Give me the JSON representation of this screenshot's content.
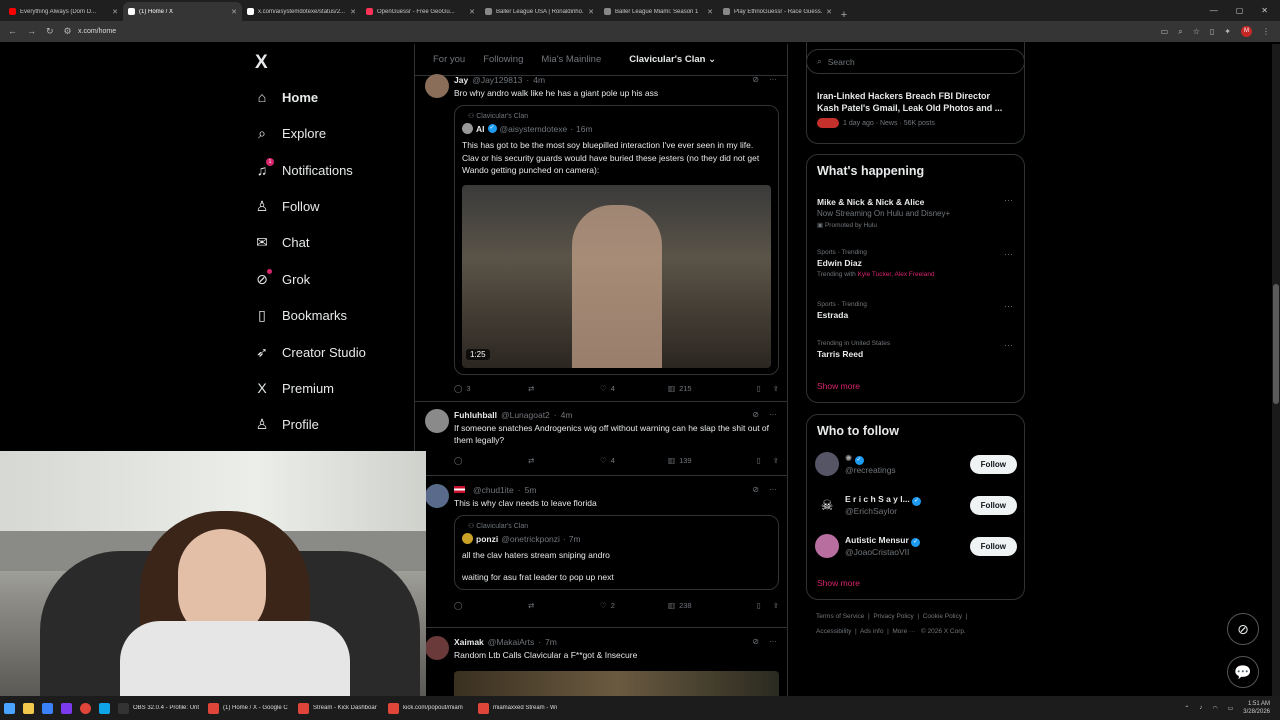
{
  "browser": {
    "tabs": [
      {
        "label": "Everything Always (Dom D...",
        "color": "#ff0000",
        "active": false
      },
      {
        "label": "(1) Home / X",
        "color": "#ffffff",
        "active": true
      },
      {
        "label": "x.com/aisystemdotexe/status/2...",
        "color": "#ffffff",
        "active": false
      },
      {
        "label": "OpenGuessr - Free GeoGu...",
        "color": "#ff3355",
        "active": false
      },
      {
        "label": "Baller League USA | Ronaldinho...",
        "color": "#888888",
        "active": false
      },
      {
        "label": "Baller League Miami: Season 1",
        "color": "#888888",
        "active": false
      },
      {
        "label": "Play EthnoGuessr - Race Guess...",
        "color": "#888888",
        "active": false
      }
    ],
    "url": "x.com/home",
    "profile_initial": "M"
  },
  "leftnav": {
    "logo": "X",
    "items": [
      {
        "label": "Home",
        "icon": "home-icon",
        "glyph": "⌂"
      },
      {
        "label": "Explore",
        "icon": "search-icon",
        "glyph": "⌕"
      },
      {
        "label": "Notifications",
        "icon": "bell-icon",
        "glyph": "♫"
      },
      {
        "label": "Follow",
        "icon": "person-plus-icon",
        "glyph": "♙"
      },
      {
        "label": "Chat",
        "icon": "mail-icon",
        "glyph": "✉"
      },
      {
        "label": "Grok",
        "icon": "grok-icon",
        "glyph": "⊘"
      },
      {
        "label": "Bookmarks",
        "icon": "bookmark-icon",
        "glyph": "▯"
      },
      {
        "label": "Creator Studio",
        "icon": "rocket-icon",
        "glyph": "➶"
      },
      {
        "label": "Premium",
        "icon": "x-premium-icon",
        "glyph": "X"
      },
      {
        "label": "Profile",
        "icon": "profile-icon",
        "glyph": "♙"
      }
    ],
    "notification_count": "1"
  },
  "timeline": {
    "tabs": [
      "For you",
      "Following",
      "Mia's Mainline",
      "Clavicular's Clan"
    ],
    "tweets": [
      {
        "name": "Jay",
        "handle": "@Jay129813",
        "time": "4m",
        "text": "Bro why andro walk like he has a giant pole up his ass",
        "quote": {
          "context": "Clavicular's Clan",
          "name": "AI",
          "handle": "@aisystemdotexe",
          "time": "16m",
          "text": "This has got to be the most soy bluepilled interaction I've ever seen in my life. Clav or his security guards would have buried these jesters (no they did not get Wando getting punched on camera):",
          "duration": "1:25"
        },
        "replies": "3",
        "reposts": "",
        "likes": "4",
        "views": "215"
      },
      {
        "name": "Fuhluhball",
        "handle": "@Lunagoat2",
        "time": "4m",
        "text": "If someone snatches Androgenics wig off without warning can he slap the shit out of them legally?",
        "replies": "",
        "reposts": "",
        "likes": "4",
        "views": "139"
      },
      {
        "name": "",
        "handle": "@chud1ite",
        "time": "5m",
        "text": "This is why clav needs to leave florida",
        "quote": {
          "context": "Clavicular's Clan",
          "name": "ponzi",
          "handle": "@onetrickponzi",
          "time": "7m",
          "line1": "all the clav haters stream sniping andro",
          "line2": "waiting for asu frat leader to pop up next"
        },
        "replies": "",
        "reposts": "",
        "likes": "2",
        "views": "238"
      },
      {
        "name": "Xaimak",
        "handle": "@MakaiArts",
        "time": "7m",
        "text": "Random Ltb Calls Clavicular a F**got & Insecure"
      }
    ]
  },
  "sidebar": {
    "search_placeholder": "Search",
    "news": {
      "headline": "Iran-Linked Hackers Breach FBI Director Kash Patel's Gmail, Leak Old Photos and ...",
      "meta": "1 day ago · News · 56K posts"
    },
    "whats_happening": {
      "title": "What's happening",
      "trends": [
        {
          "meta": "",
          "name": "Mike & Nick & Nick & Alice",
          "sub": "Now Streaming On Hulu and Disney+",
          "promo": "Promoted by Hulu"
        },
        {
          "meta": "Sports · Trending",
          "name": "Edwin Diaz",
          "trending_with": "Trending with",
          "names": "Kyle Tucker, Alex Freeland"
        },
        {
          "meta": "Sports · Trending",
          "name": "Estrada"
        },
        {
          "meta": "Trending in United States",
          "name": "Tarris Reed"
        }
      ],
      "show_more": "Show more"
    },
    "who_to_follow": {
      "title": "Who to follow",
      "accounts": [
        {
          "name": "",
          "handle": "@recreatings",
          "button": "Follow"
        },
        {
          "name": "E r i c h  S a y l...",
          "handle": "@ErichSaylor",
          "button": "Follow"
        },
        {
          "name": "Autistic Mensur",
          "handle": "@JoaoCristaoVII",
          "button": "Follow"
        }
      ],
      "show_more": "Show more"
    },
    "footer": {
      "links": [
        "Terms of Service",
        "Privacy Policy",
        "Cookie Policy",
        "Accessibility",
        "Ads info",
        "More ···"
      ],
      "copyright": "© 2026 X Corp."
    }
  },
  "taskbar": {
    "apps": [
      {
        "label": "OBS 32.0.4 - Profile: Unt",
        "color": "#333333"
      },
      {
        "label": "(1) Home / X - Google C",
        "color": "#e0453a"
      },
      {
        "label": "Stream - Kick Dashboar",
        "color": "#e0453a"
      },
      {
        "label": "kick.com/popout/miam",
        "color": "#e0453a"
      },
      {
        "label": "miamaxxed Stream - Wi",
        "color": "#e0453a"
      }
    ],
    "time": "1:51 AM",
    "date": "3/28/2026"
  }
}
